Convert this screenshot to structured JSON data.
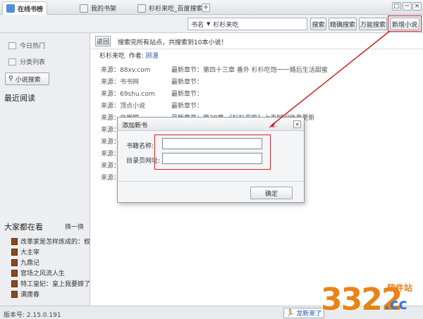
{
  "tabs": [
    {
      "label": "在线书榜",
      "active": true
    },
    {
      "label": "我的书架",
      "active": false
    },
    {
      "label": "杉杉来吃_百度搜索",
      "active": false
    }
  ],
  "tab_add": "+",
  "window_controls": {
    "restore": "□",
    "minimize": "─",
    "close": "×"
  },
  "toolbar": {
    "search_category": "书名",
    "search_value": "杉杉来吃",
    "buttons": [
      "搜索",
      "精确搜索",
      "万能搜索",
      "新增小说"
    ]
  },
  "sidebar": {
    "items": [
      "今日热门",
      "分类列表"
    ],
    "search_button": "小说搜索",
    "recent_title": "最近阅读",
    "popular_title": "大家都在看",
    "swap_label": "换一换",
    "popular_books": [
      "改革家是怎样炼成的：叙时",
      "大主宰",
      "九鼎记",
      "官场之风流人生",
      "特工皇妃：皇上我要嫁了你",
      "满唐春"
    ]
  },
  "main": {
    "back_label": "返回",
    "status": "搜索完所有站点，共搜索到10本小说！",
    "novel_title": "杉杉来吃",
    "author_label": "作者:",
    "author": "顾漫",
    "sources": [
      {
        "site": "来源：88xv.com",
        "chapter": "最新章节：第四十三章 番外 杉杉吃饱一一婚后生活甜蜜"
      },
      {
        "site": "来源：书书网",
        "chapter": "最新章节："
      },
      {
        "site": "来源：69shu.com",
        "chapter": "最新章节："
      },
      {
        "site": "来源：顶点小说",
        "chapter": "最新章节："
      },
      {
        "site": "来源：文学馆",
        "chapter": "最新章节：第28章 《杉杉来吃》上市时间信息更新"
      },
      {
        "site": "来源：",
        "chapter": ""
      },
      {
        "site": "来源：",
        "chapter": ""
      },
      {
        "site": "来源：",
        "chapter": ""
      },
      {
        "site": "来源：",
        "chapter": ""
      },
      {
        "site": "来源：",
        "chapter": ""
      }
    ]
  },
  "dialog": {
    "title": "添加新书",
    "book_name_label": "书籍名称:",
    "book_name_value": "",
    "catalog_url_label": "目录页网址:",
    "catalog_url_value": "",
    "ok_label": "确定",
    "close_symbol": "×"
  },
  "status_bar": {
    "version": "版本号: 2.15.0.191",
    "button_label": "龙新来了"
  },
  "watermark": {
    "number": "3322",
    "suffix": ".cc",
    "site": "软件站"
  },
  "colors": {
    "highlight": "#d42020",
    "accent": "#2a5db0",
    "watermark_orange": "#e8831a",
    "watermark_blue": "#2e7fd6"
  }
}
